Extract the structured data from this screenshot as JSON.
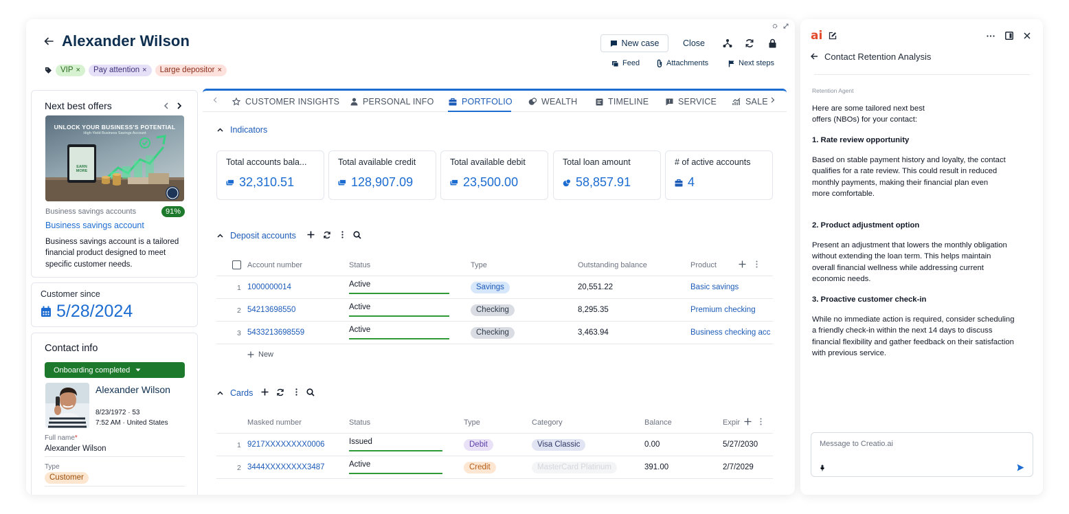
{
  "header": {
    "title": "Alexander Wilson",
    "tags": [
      {
        "label": "VIP",
        "remove": "×"
      },
      {
        "label": "Pay attention",
        "remove": "×"
      },
      {
        "label": "Large depositor",
        "remove": "×"
      }
    ],
    "new_case_label": "New case",
    "close_label": "Close",
    "feed_label": "Feed",
    "attachments_label": "Attachments",
    "next_steps_label": "Next steps"
  },
  "next_best_offers": {
    "title": "Next best offers",
    "image_headline": "UNLOCK YOUR BUSINESS'S POTENTIAL",
    "image_subline": "High-Yield Business Savings Account",
    "image_button": "EARN MORE",
    "category": "Business savings accounts",
    "match": "91%",
    "offer_link": "Business savings account",
    "description": "Business savings account is a tailored financial product designed to meet specific customer needs."
  },
  "customer_since": {
    "label": "Customer since",
    "value": "5/28/2024"
  },
  "contact_info": {
    "title": "Contact info",
    "stage": "Onboarding completed",
    "name": "Alexander Wilson",
    "dob": "8/23/1972 · 53",
    "local_time": "7:52 AM · United States",
    "full_name_label": "Full name",
    "required_mark": "*",
    "full_name_value": "Alexander Wilson",
    "type_label": "Type",
    "type_value": "Customer"
  },
  "tabs": {
    "items": [
      {
        "label": "CUSTOMER INSIGHTS",
        "icon": "star-icon"
      },
      {
        "label": "PERSONAL INFO",
        "icon": "person-icon"
      },
      {
        "label": "PORTFOLIO",
        "icon": "briefcase-icon"
      },
      {
        "label": "WEALTH",
        "icon": "wealth-icon"
      },
      {
        "label": "TIMELINE",
        "icon": "timeline-icon"
      },
      {
        "label": "SERVICE",
        "icon": "service-icon"
      },
      {
        "label": "SALE",
        "icon": "sales-icon"
      }
    ],
    "active": "PORTFOLIO"
  },
  "indicators": {
    "title": "Indicators",
    "kpis": [
      {
        "label": "Total accounts bala...",
        "value": "32,310.51"
      },
      {
        "label": "Total available credit",
        "value": "128,907.09"
      },
      {
        "label": "Total available debit",
        "value": "23,500.00"
      },
      {
        "label": "Total loan amount",
        "value": "58,857.91"
      },
      {
        "label": "# of active accounts",
        "value": "4"
      }
    ]
  },
  "deposit_accounts": {
    "title": "Deposit accounts",
    "columns": [
      "Account number",
      "Status",
      "Type",
      "Outstanding balance",
      "Product"
    ],
    "rows": [
      {
        "num": "1",
        "account": "1000000014",
        "status": "Active",
        "type": "Savings",
        "balance": "20,551.22",
        "product": "Basic savings"
      },
      {
        "num": "2",
        "account": "54213698550",
        "status": "Active",
        "type": "Checking",
        "balance": "8,295.35",
        "product": "Premium checking"
      },
      {
        "num": "3",
        "account": "5433213698559",
        "status": "Active",
        "type": "Checking",
        "balance": "3,463.94",
        "product": "Business checking acc"
      }
    ],
    "new_label": "New"
  },
  "cards": {
    "title": "Cards",
    "columns": [
      "Masked number",
      "Status",
      "Type",
      "Category",
      "Balance",
      "Expir"
    ],
    "rows": [
      {
        "num": "1",
        "masked": "9217XXXXXXXX0006",
        "status": "Issued",
        "type": "Debit",
        "category": "Visa Classic",
        "balance": "0.00",
        "expiry": "5/27/2030"
      },
      {
        "num": "2",
        "masked": "3444XXXXXXXX3487",
        "status": "Active",
        "type": "Credit",
        "category": "MasterCard Platinum",
        "balance": "391.00",
        "expiry": "2/7/2029"
      }
    ]
  },
  "ai_panel": {
    "logo": "ai",
    "title": "Contact Retention Analysis",
    "agent": "Retention Agent",
    "intro": "Here are some tailored next best offers (NBOs) for your contact:",
    "h1": "1. Rate review opportunity",
    "p1": "Based on stable payment history and loyalty, the contact qualifies for a rate review. This could result in reduced monthly payments, making their financial plan even more comfortable.",
    "h2": "2. Product adjustment option",
    "p2": "Present an adjustment that lowers the monthly obligation without extending the loan term. This helps maintain overall financial wellness while addressing current economic needs.",
    "h3": "3. Proactive customer check-in",
    "p3": "While no immediate action is required, consider scheduling a friendly check-in within the next 14 days to discuss financial flexibility and gather feedback on their satisfaction with previous service.",
    "composer_placeholder": "Message to Creatio.ai"
  },
  "colors": {
    "accent": "#1c6cd1",
    "title": "#0d2e4e",
    "success": "#1d7a2c"
  }
}
